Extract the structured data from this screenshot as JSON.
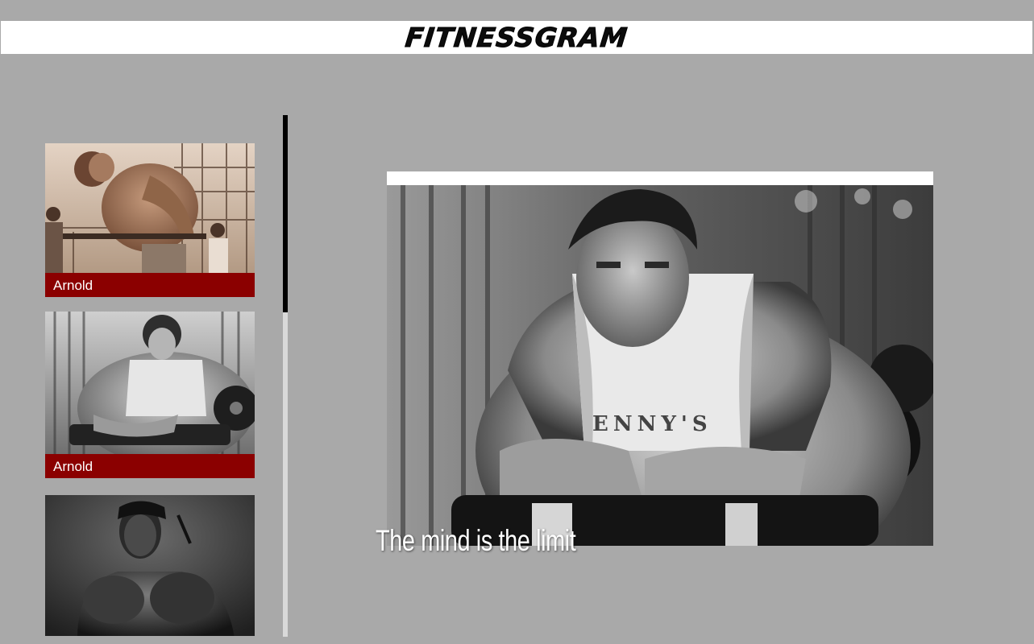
{
  "header": {
    "brand": "FITNESSGRAM"
  },
  "sidebar": {
    "cards": [
      {
        "caption": "Arnold",
        "photo": "arnold-dips-sepia"
      },
      {
        "caption": "Arnold",
        "photo": "arnold-preacher-bench"
      },
      {
        "caption": "",
        "photo": "bodybuilder-portrait"
      }
    ]
  },
  "main": {
    "photo": "arnold-preacher-bench-large",
    "quote": "The mind is the limit"
  },
  "colors": {
    "background": "#a9a9a9",
    "header_bg": "#ffffff",
    "caption_bg": "#8b0000",
    "caption_text": "#ffffff",
    "scroll_thumb": "#000000",
    "scroll_track": "#d9d9d9"
  }
}
